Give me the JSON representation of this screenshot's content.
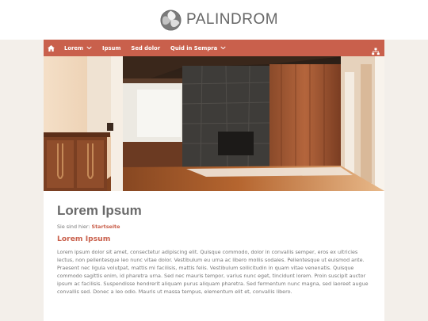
{
  "header": {
    "brand": "PALINDROM",
    "logo_icon": "palindrom-logo-icon"
  },
  "nav": {
    "home_icon": "home-icon",
    "items": [
      {
        "label": "Lorem",
        "has_dropdown": true
      },
      {
        "label": "Ipsum",
        "has_dropdown": false
      },
      {
        "label": "Sed dolor",
        "has_dropdown": false
      },
      {
        "label": "Quid in Sempra",
        "has_dropdown": true
      }
    ],
    "right_icon": "sitemap-icon",
    "color": "#c9604c"
  },
  "hero": {
    "image": "interior-room-photo"
  },
  "main": {
    "title": "Lorem Ipsum",
    "breadcrumb_prefix": "Sie sind hier:",
    "breadcrumb_link": "Startseite",
    "section_title": "Lorem Ipsum",
    "body": "Lorem ipsum dolor sit amet, consectetur adipiscing elit. Quisque commodo, dolor in convallis semper, eros ex ultricies lectus, non pellentesque leo nunc vitae dolor. Vestibulum eu urna ac libero mollis sodales. Pellentesque ut euismod ante. Praesent nec ligula volutpat, mattis mi facilisis, mattis felis. Vestibulum sollicitudin in quam vitae venenatis. Quisque commodo sagittis enim, id pharetra urna. Sed nec mauris tempor, varius nunc eget, tincidunt lorem. Proin suscipit auctor ipsum ac facilisis. Suspendisse hendrerit aliquam purus aliquam pharetra. Sed fermentum nunc magna, sed laoreet augue convallis sed. Donec a leo odio. Mauris ut massa tempus, elementum elit et, convallis libero."
  }
}
